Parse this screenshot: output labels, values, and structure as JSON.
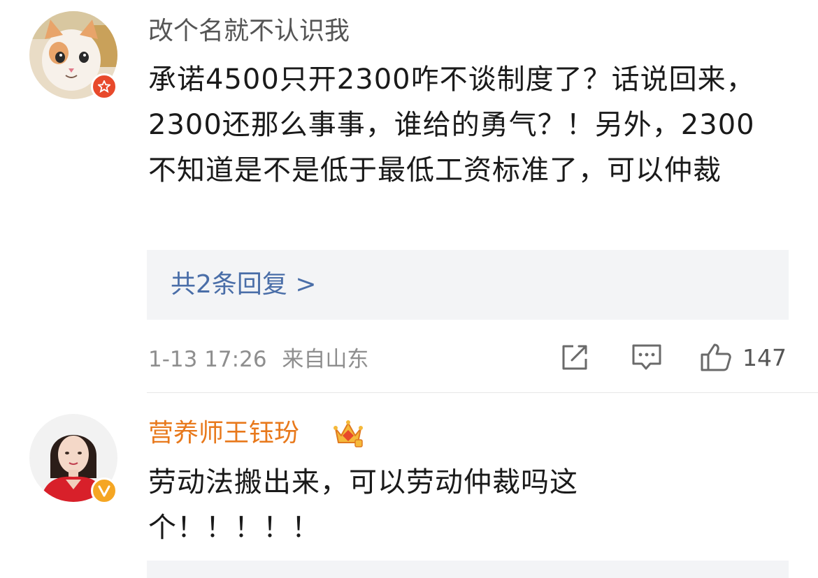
{
  "comments": [
    {
      "username": "改个名就不认识我",
      "text": "承诺4500只开2300咋不谈制度了？话说回来，2300还那么事事，谁给的勇气？！另外，2300不知道是不是低于最低工资标准了，可以仲裁",
      "replies_link": "共2条回复 >",
      "date": "1-13 17:26",
      "location": "来自山东",
      "like_count": "147",
      "icons": [
        "avatar-cat",
        "star-badge-icon",
        "share-icon",
        "comment-icon",
        "like-icon"
      ]
    },
    {
      "username": "营养师王钰玢",
      "text": "劳动法搬出来，可以劳动仲裁吗这个！！！！！",
      "icons": [
        "avatar-woman",
        "verified-v-badge-icon",
        "vip-crown-icon"
      ]
    }
  ],
  "colors": {
    "username_normal": "#555555",
    "username_vip": "#e8791c",
    "link": "#4a6ea8",
    "reply_bg": "#f3f4f6",
    "meta": "#8e8e8e"
  }
}
